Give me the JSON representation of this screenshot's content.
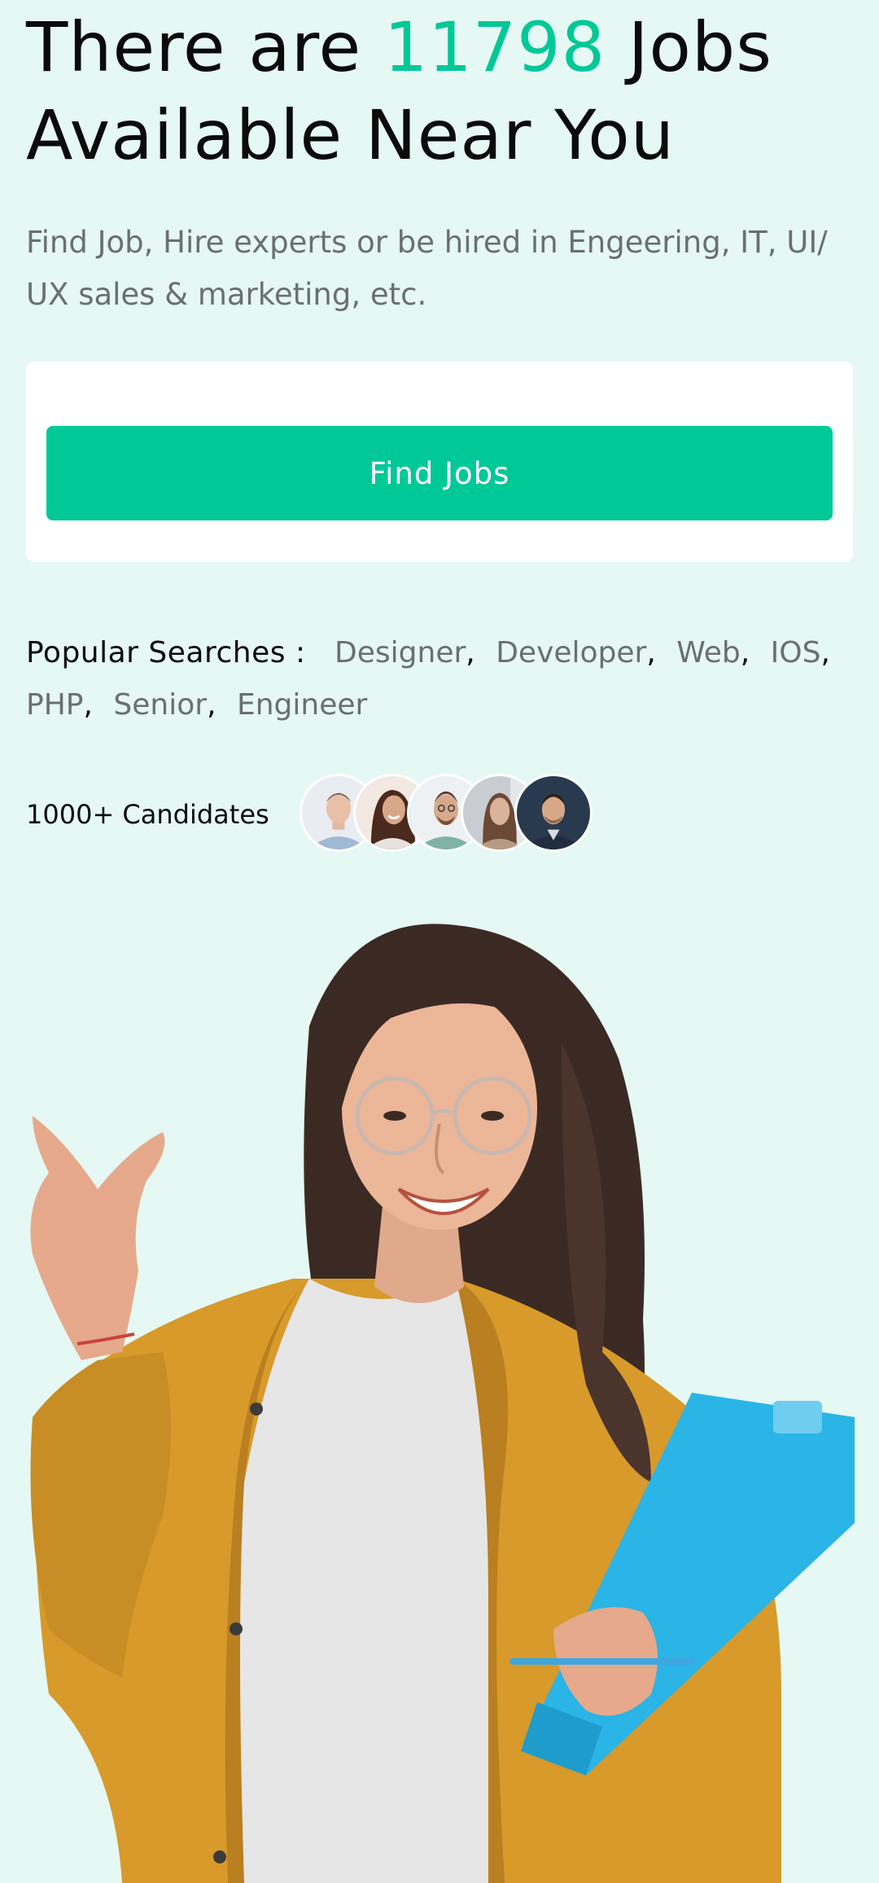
{
  "hero": {
    "headline_pre": "There are ",
    "job_count": "11798",
    "headline_post": " Jobs",
    "headline_line2": "Available Near You",
    "subtitle": "Find Job, Hire experts or be hired in Engeering, IT, UI/ UX sales & marketing, etc."
  },
  "search": {
    "button_label": "Find Jobs"
  },
  "popular": {
    "label": "Popular Searches :",
    "tags": [
      "Designer",
      "Developer",
      "Web",
      "IOS",
      "PHP",
      "Senior",
      "Engineer"
    ]
  },
  "candidates": {
    "label": "1000+ Candidates",
    "avatars": [
      "avatar-man-1",
      "avatar-woman-1",
      "avatar-man-2",
      "avatar-woman-2",
      "avatar-man-3"
    ]
  },
  "colors": {
    "accent": "#00c896",
    "background": "#e5f8f3",
    "card": "#ffffff",
    "muted_text": "#6b6f6e"
  }
}
